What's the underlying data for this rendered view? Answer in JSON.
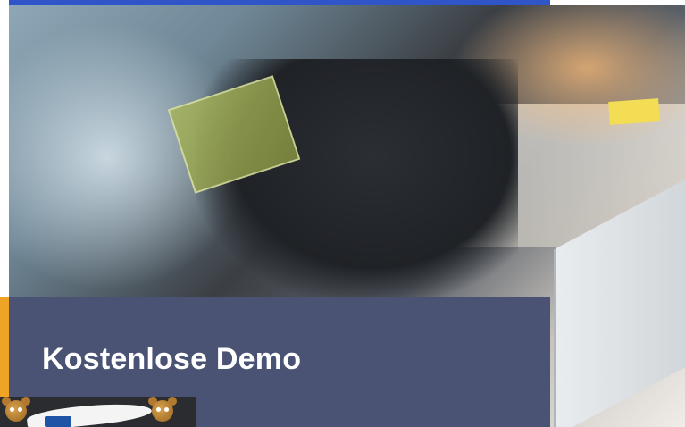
{
  "demo": {
    "title": "Kostenlose Demo"
  },
  "colors": {
    "top_accent": "#2f55c9",
    "panel": "#4a5373",
    "orange_bar": "#f0a426",
    "title_text": "#ffffff"
  },
  "images": {
    "hero": "hero-photo-people-at-laptop",
    "thumbnail": "mascot-thumbnail"
  }
}
